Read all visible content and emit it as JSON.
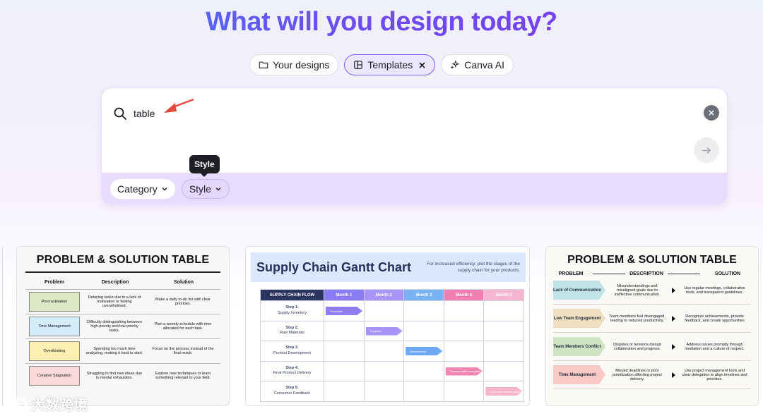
{
  "hero": {
    "title": "What will you design today?"
  },
  "tabs": [
    {
      "label": "Your designs",
      "icon": "folder-icon"
    },
    {
      "label": "Templates",
      "icon": "template-icon",
      "active": true,
      "closable": true
    },
    {
      "label": "Canva AI",
      "icon": "sparkle-icon"
    }
  ],
  "search": {
    "query": "table",
    "filters": {
      "category_label": "Category",
      "style_label": "Style"
    },
    "tooltip": "Style"
  },
  "results": {
    "card1": {
      "title": "PROBLEM & SOLUTION TABLE",
      "headers": [
        "Problem",
        "Description",
        "Solution"
      ],
      "rows": [
        {
          "problem": "Procrastination",
          "description": "Delaying tasks due to a lack of motivation or feeling overwhelmed.",
          "solution": "Make a daily to-do list with clear priorities.",
          "color": "#dfe8c4"
        },
        {
          "problem": "Time Management",
          "description": "Difficulty distinguishing between high-priority and low-priority tasks.",
          "solution": "Plan a weekly schedule with time allocated for each task.",
          "color": "#d5ecfb"
        },
        {
          "problem": "Overthinking",
          "description": "Spending too much time analyzing, making it hard to start.",
          "solution": "Focus on the process instead of the final result.",
          "color": "#fcefb2"
        },
        {
          "problem": "Creative Stagnation",
          "description": "Struggling to find new ideas due to mental exhaustion.",
          "solution": "Explore new techniques or learn something relevant to your field.",
          "color": "#fcdada"
        }
      ]
    },
    "card2": {
      "title": "Supply Chain Gantt Chart",
      "subtitle": "For increased efficiency, plot the stages of the supply chain for your products.",
      "header_first": "SUPPLY CHAIN FLOW",
      "months": [
        "Month 1",
        "Month 2",
        "Month 3",
        "Month 4",
        "Month 5"
      ],
      "month_colors": [
        "#8b7cf6",
        "#a995f7",
        "#7ab3f4",
        "#f27fb2",
        "#f7b6cf"
      ],
      "steps": [
        {
          "step": "Step 1:",
          "name": "Supply Inventory"
        },
        {
          "step": "Step 2:",
          "name": "Raw Materials"
        },
        {
          "step": "Step 3:",
          "name": "Product Development"
        },
        {
          "step": "Step 4:",
          "name": "Final Product Delivery"
        },
        {
          "step": "Step 5:",
          "name": "Consumer Feedback"
        }
      ],
      "bars": [
        {
          "col": 1,
          "label": "Producers",
          "color": "#8e7ef5"
        },
        {
          "col": 2,
          "label": "Suppliers",
          "color": "#a792f5"
        },
        {
          "col": 3,
          "label": "Manufacturer",
          "color": "#6ea7f2"
        },
        {
          "col": 4,
          "label": "Transportation company",
          "color": "#ef86b3"
        },
        {
          "col": 5,
          "label": "Customer service support",
          "color": "#f5b3cb"
        }
      ]
    },
    "card3": {
      "title": "PROBLEM & SOLUTION TABLE",
      "headers": [
        "PROBLEM",
        "DESCRIPTION",
        "SOLUTION"
      ],
      "rows": [
        {
          "problem": "Lack of Communication",
          "description": "Misunderstandings and misaligned goals due to ineffective communication.",
          "solution": "Use regular meetings, collaborative tools, and transparent guidelines.",
          "color": "#bfe3e8"
        },
        {
          "problem": "Low Team Engagement",
          "description": "Team members feel disengaged, leading to reduced productivity.",
          "solution": "Recognize achievements, provide feedback, and create opportunities",
          "color": "#f1dfc1"
        },
        {
          "problem": "Team Members Conflict",
          "description": "Disputes or tensions disrupt collaboration and progress.",
          "solution": "Address issues promptly through mediation and a culture of respect.",
          "color": "#cfe3c5"
        },
        {
          "problem": "Time Management",
          "description": "Missed deadlines or poor prioritization affecting project delivery.",
          "solution": "Use project management tools and clear delegation to align timelines and priorities.",
          "color": "#f8c9c5"
        }
      ]
    }
  },
  "watermark": {
    "text": "大数跨境"
  }
}
